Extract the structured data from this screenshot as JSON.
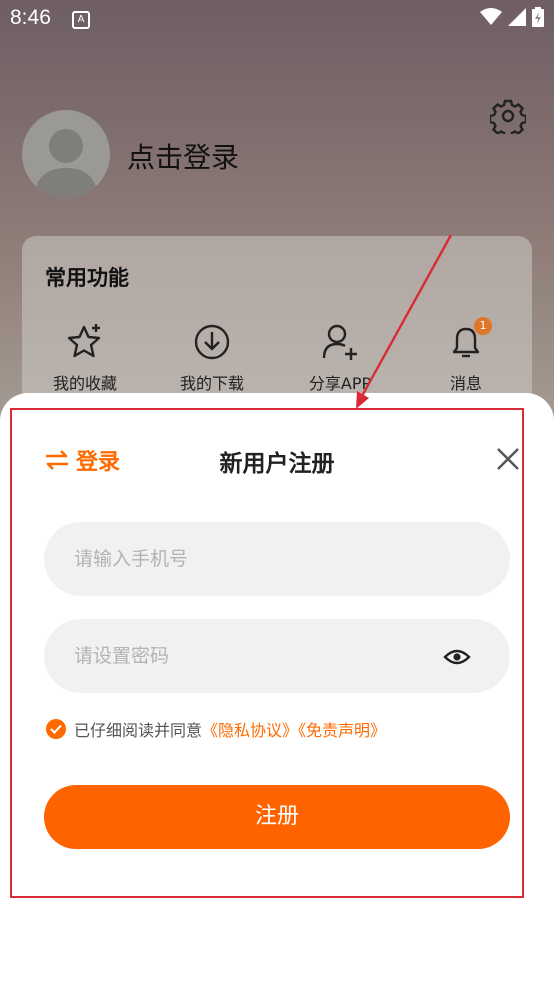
{
  "status_bar": {
    "time": "8:46",
    "notification_icon": "A"
  },
  "profile": {
    "login_prompt": "点击登录"
  },
  "common_functions": {
    "title": "常用功能",
    "items": [
      {
        "label": "我的收藏",
        "icon": "star-plus-icon"
      },
      {
        "label": "我的下载",
        "icon": "download-icon"
      },
      {
        "label": "分享APP",
        "icon": "add-user-icon"
      },
      {
        "label": "消息",
        "icon": "bell-icon",
        "badge": "1"
      }
    ]
  },
  "register_sheet": {
    "switch_login_label": "登录",
    "title": "新用户注册",
    "phone_placeholder": "请输入手机号",
    "password_placeholder": "请设置密码",
    "agreement_text": "已仔细阅读并同意",
    "privacy_link": "《隐私协议》",
    "disclaimer_link": "《免责声明》",
    "register_label": "注册"
  },
  "colors": {
    "accent": "#ff6300",
    "highlight_border": "#d92b35"
  }
}
